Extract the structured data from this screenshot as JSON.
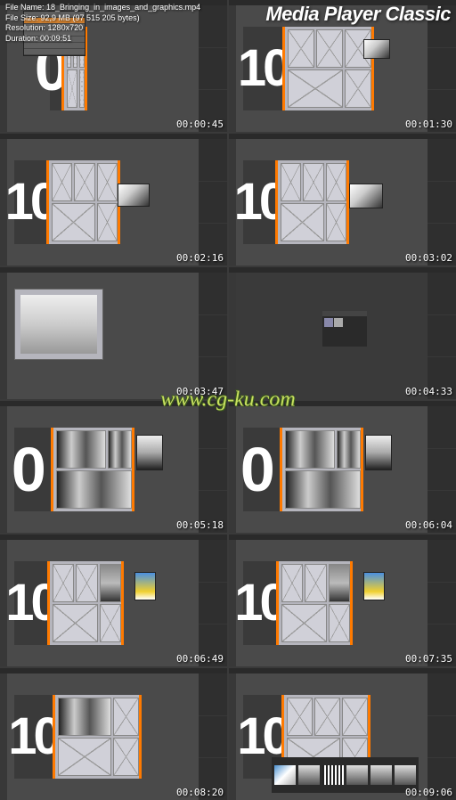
{
  "app": {
    "title": "Media Player Classic"
  },
  "file_info": {
    "name_label": "File Name:",
    "name": "18_Bringing_in_images_and_graphics.mp4",
    "size_label": "File Size:",
    "size": "92,9 MB (97 515 205 bytes)",
    "resolution_label": "Resolution:",
    "resolution": "1280x720",
    "duration_label": "Duration:",
    "duration": "00:09:51"
  },
  "watermark": "www.cg-ku.com",
  "layout_number": "10",
  "thumbs": [
    {
      "timecode": "00:00:45"
    },
    {
      "timecode": "00:01:30"
    },
    {
      "timecode": "00:02:16"
    },
    {
      "timecode": "00:03:02"
    },
    {
      "timecode": "00:03:47"
    },
    {
      "timecode": "00:04:33"
    },
    {
      "timecode": "00:05:18"
    },
    {
      "timecode": "00:06:04"
    },
    {
      "timecode": "00:06:49"
    },
    {
      "timecode": "00:07:35"
    },
    {
      "timecode": "00:08:20"
    },
    {
      "timecode": "00:09:06"
    }
  ]
}
